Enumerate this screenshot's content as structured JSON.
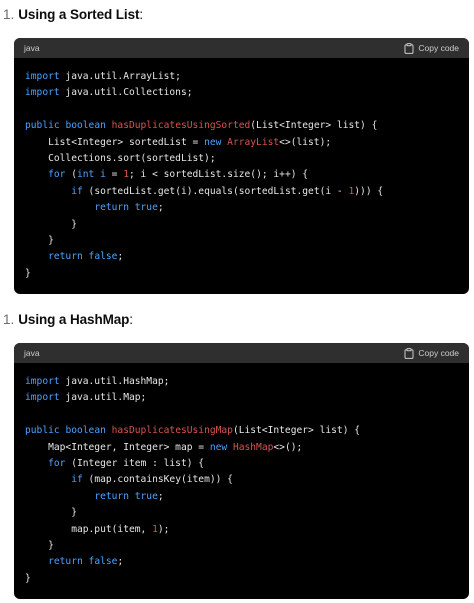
{
  "sections": [
    {
      "number": "1.",
      "title": "Using a Sorted List",
      "colon": ":",
      "code_language": "java",
      "copy_label": "Copy code",
      "lines": [
        [
          {
            "t": "import",
            "c": "kw"
          },
          {
            "t": " java.util.ArrayList;",
            "c": "pl"
          }
        ],
        [
          {
            "t": "import",
            "c": "kw"
          },
          {
            "t": " java.util.Collections;",
            "c": "pl"
          }
        ],
        [],
        [
          {
            "t": "public",
            "c": "kw"
          },
          {
            "t": " ",
            "c": "pl"
          },
          {
            "t": "boolean",
            "c": "kw"
          },
          {
            "t": " ",
            "c": "pl"
          },
          {
            "t": "hasDuplicatesUsingSorted",
            "c": "fn"
          },
          {
            "t": "(List<Integer> list) {",
            "c": "pl"
          }
        ],
        [
          {
            "t": "    List<Integer> sortedList = ",
            "c": "pl"
          },
          {
            "t": "new",
            "c": "kw"
          },
          {
            "t": " ",
            "c": "pl"
          },
          {
            "t": "ArrayList",
            "c": "fn"
          },
          {
            "t": "<>(list);",
            "c": "pl"
          }
        ],
        [
          {
            "t": "    Collections.sort(sortedList);",
            "c": "pl"
          }
        ],
        [
          {
            "t": "    ",
            "c": "pl"
          },
          {
            "t": "for",
            "c": "kw"
          },
          {
            "t": " (",
            "c": "pl"
          },
          {
            "t": "int",
            "c": "kw"
          },
          {
            "t": " ",
            "c": "pl"
          },
          {
            "t": "i",
            "c": "kw"
          },
          {
            "t": " = ",
            "c": "pl"
          },
          {
            "t": "1",
            "c": "nm"
          },
          {
            "t": "; i < sortedList.size(); i++) {",
            "c": "pl"
          }
        ],
        [
          {
            "t": "        ",
            "c": "pl"
          },
          {
            "t": "if",
            "c": "kw"
          },
          {
            "t": " (sortedList.get(i).equals(sortedList.get(i - ",
            "c": "pl"
          },
          {
            "t": "1",
            "c": "nm"
          },
          {
            "t": "))) {",
            "c": "pl"
          }
        ],
        [
          {
            "t": "            ",
            "c": "pl"
          },
          {
            "t": "return",
            "c": "kw"
          },
          {
            "t": " ",
            "c": "pl"
          },
          {
            "t": "true",
            "c": "kw"
          },
          {
            "t": ";",
            "c": "pl"
          }
        ],
        [
          {
            "t": "        }",
            "c": "pl"
          }
        ],
        [
          {
            "t": "    }",
            "c": "pl"
          }
        ],
        [
          {
            "t": "    ",
            "c": "pl"
          },
          {
            "t": "return",
            "c": "kw"
          },
          {
            "t": " ",
            "c": "pl"
          },
          {
            "t": "false",
            "c": "kw"
          },
          {
            "t": ";",
            "c": "pl"
          }
        ],
        [
          {
            "t": "}",
            "c": "pl"
          }
        ]
      ]
    },
    {
      "number": "1.",
      "title": "Using a HashMap",
      "colon": ":",
      "code_language": "java",
      "copy_label": "Copy code",
      "lines": [
        [
          {
            "t": "import",
            "c": "kw"
          },
          {
            "t": " java.util.HashMap;",
            "c": "pl"
          }
        ],
        [
          {
            "t": "import",
            "c": "kw"
          },
          {
            "t": " java.util.Map;",
            "c": "pl"
          }
        ],
        [],
        [
          {
            "t": "public",
            "c": "kw"
          },
          {
            "t": " ",
            "c": "pl"
          },
          {
            "t": "boolean",
            "c": "kw"
          },
          {
            "t": " ",
            "c": "pl"
          },
          {
            "t": "hasDuplicatesUsingMap",
            "c": "fn"
          },
          {
            "t": "(List<Integer> list) {",
            "c": "pl"
          }
        ],
        [
          {
            "t": "    Map<Integer, Integer> map = ",
            "c": "pl"
          },
          {
            "t": "new",
            "c": "kw"
          },
          {
            "t": " ",
            "c": "pl"
          },
          {
            "t": "HashMap",
            "c": "fn"
          },
          {
            "t": "<>();",
            "c": "pl"
          }
        ],
        [
          {
            "t": "    ",
            "c": "pl"
          },
          {
            "t": "for",
            "c": "kw"
          },
          {
            "t": " (Integer item : list) {",
            "c": "pl"
          }
        ],
        [
          {
            "t": "        ",
            "c": "pl"
          },
          {
            "t": "if",
            "c": "kw"
          },
          {
            "t": " (map.containsKey(item)) {",
            "c": "pl"
          }
        ],
        [
          {
            "t": "            ",
            "c": "pl"
          },
          {
            "t": "return",
            "c": "kw"
          },
          {
            "t": " ",
            "c": "pl"
          },
          {
            "t": "true",
            "c": "kw"
          },
          {
            "t": ";",
            "c": "pl"
          }
        ],
        [
          {
            "t": "        }",
            "c": "pl"
          }
        ],
        [
          {
            "t": "        map.put(item, ",
            "c": "pl"
          },
          {
            "t": "1",
            "c": "nm"
          },
          {
            "t": ");",
            "c": "pl"
          }
        ],
        [
          {
            "t": "    }",
            "c": "pl"
          }
        ],
        [
          {
            "t": "    ",
            "c": "pl"
          },
          {
            "t": "return",
            "c": "kw"
          },
          {
            "t": " ",
            "c": "pl"
          },
          {
            "t": "false",
            "c": "kw"
          },
          {
            "t": ";",
            "c": "pl"
          }
        ],
        [
          {
            "t": "}",
            "c": "pl"
          }
        ]
      ]
    }
  ],
  "colors": {
    "keyword": "#4aa3ff",
    "function": "#d9534f",
    "number": "#d9534f",
    "plain": "#e6e6e6",
    "code_bg": "#000000",
    "header_bg": "#2f2f2f"
  },
  "icons": {
    "copy": "clipboard-icon"
  }
}
